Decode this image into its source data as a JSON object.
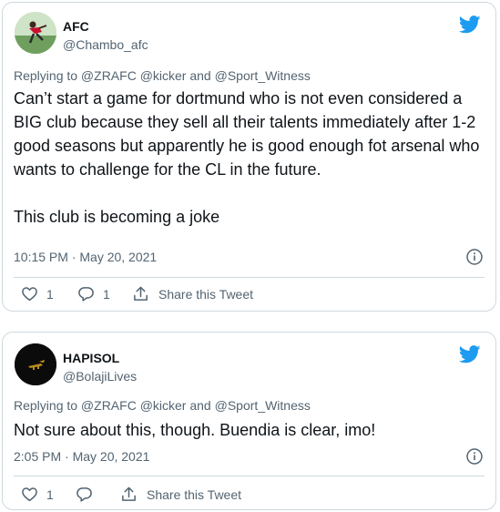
{
  "colors": {
    "brand_blue": "#1d9bf0",
    "muted": "#536471",
    "text": "#0f1419",
    "border": "#cfd9de"
  },
  "tweets": [
    {
      "name": "AFC",
      "handle": "@Chambo_afc",
      "replying_to": "Replying to @ZRAFC @kicker and @Sport_Witness",
      "text_p1": "Can’t start a game for dortmund who is not even considered a BIG club because they sell all their talents immediately after 1-2 good seasons but apparently he is good enough fot arsenal who wants to challenge for the CL in the future.",
      "text_p2": "This club is becoming a joke",
      "timestamp": "10:15 PM · May 20, 2021",
      "likes": "1",
      "replies": "1",
      "share_label": "Share this Tweet"
    },
    {
      "name": "HAPISOL",
      "handle": "@BolajiLives",
      "replying_to": "Replying to @ZRAFC @kicker and @Sport_Witness",
      "text_p1": "Not sure about this, though. Buendia is clear, imo!",
      "timestamp": "2:05 PM · May 20, 2021",
      "likes": "1",
      "replies": "",
      "share_label": "Share this Tweet"
    }
  ],
  "icons": [
    "twitter-bird-icon",
    "info-icon",
    "heart-icon",
    "reply-icon",
    "share-icon"
  ]
}
